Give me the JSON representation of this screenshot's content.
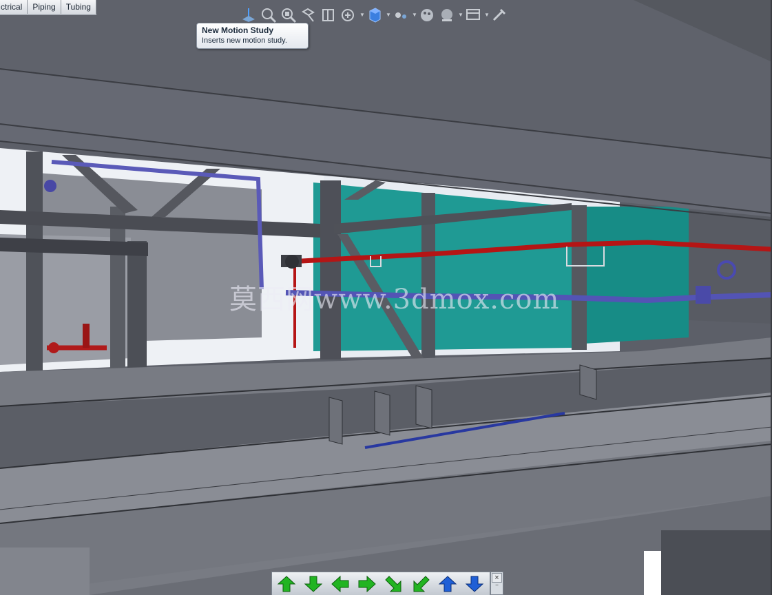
{
  "tabs": [
    {
      "label": "ctrical"
    },
    {
      "label": "Piping"
    },
    {
      "label": "Tubing"
    }
  ],
  "hud_toolbar": {
    "items": [
      {
        "icon": "view-orientation-icon"
      },
      {
        "icon": "zoom-to-fit-icon"
      },
      {
        "icon": "zoom-to-area-icon"
      },
      {
        "icon": "previous-view-icon"
      },
      {
        "icon": "section-view-icon"
      },
      {
        "icon": "dynamic-annotation-icon"
      },
      {
        "icon": "display-style-icon"
      },
      {
        "icon": "hide-show-items-icon"
      },
      {
        "icon": "edit-appearance-icon"
      },
      {
        "icon": "apply-scene-icon"
      },
      {
        "icon": "view-settings-icon"
      },
      {
        "icon": "new-motion-study-icon"
      }
    ]
  },
  "tooltip": {
    "title": "New Motion Study",
    "description": "Inserts new motion study."
  },
  "watermark": "莫西网www.3dmox.com",
  "navigation": {
    "buttons": [
      {
        "icon": "arrow-up-green-icon",
        "color": "#22b422"
      },
      {
        "icon": "arrow-down-green-icon",
        "color": "#22b422"
      },
      {
        "icon": "arrow-left-green-icon",
        "color": "#22b422"
      },
      {
        "icon": "arrow-right-green-icon",
        "color": "#22b422"
      },
      {
        "icon": "arrow-down-right-green-icon",
        "color": "#22b422"
      },
      {
        "icon": "arrow-down-left-green-icon",
        "color": "#22b422"
      },
      {
        "icon": "arrow-up-blue-icon",
        "color": "#1f5fd6"
      },
      {
        "icon": "arrow-down-blue-icon",
        "color": "#1f5fd6"
      }
    ],
    "close_label": "×",
    "pin_label": "‾"
  },
  "colors": {
    "structure": "#5f626b",
    "deck": "#7e8189",
    "teal_panel": "#1f9a94",
    "pipe_red": "#c11818",
    "pipe_blue": "#5050b8",
    "sky": "#f3f5f8"
  }
}
